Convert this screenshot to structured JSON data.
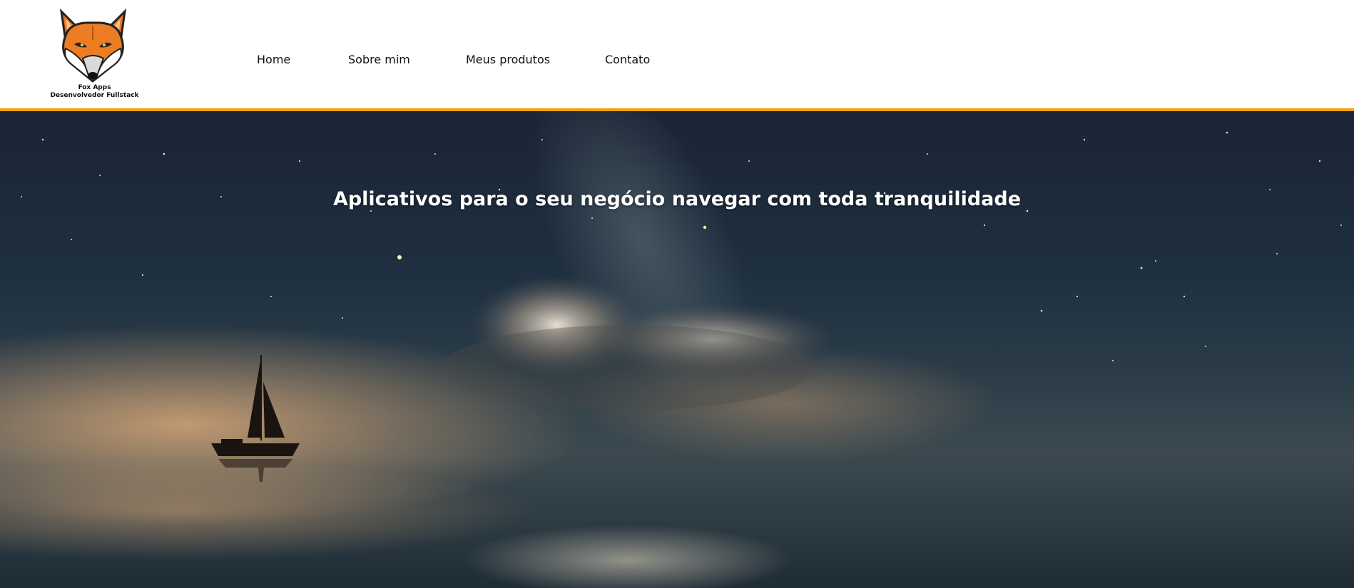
{
  "brand": {
    "name": "Fox Apps",
    "tagline": "Desenvolvedor Fullstack",
    "logo_icon": "fox-head-icon"
  },
  "nav": {
    "items": [
      {
        "label": "Home"
      },
      {
        "label": "Sobre mim"
      },
      {
        "label": "Meus produtos"
      },
      {
        "label": "Contato"
      }
    ]
  },
  "hero": {
    "title": "Aplicativos para o seu negócio navegar com toda tranquilidade",
    "background": "night-sea-sailboat-image"
  },
  "colors": {
    "accent": "#f2a20c",
    "header_bg": "#ffffff",
    "hero_text": "#ffffff"
  }
}
